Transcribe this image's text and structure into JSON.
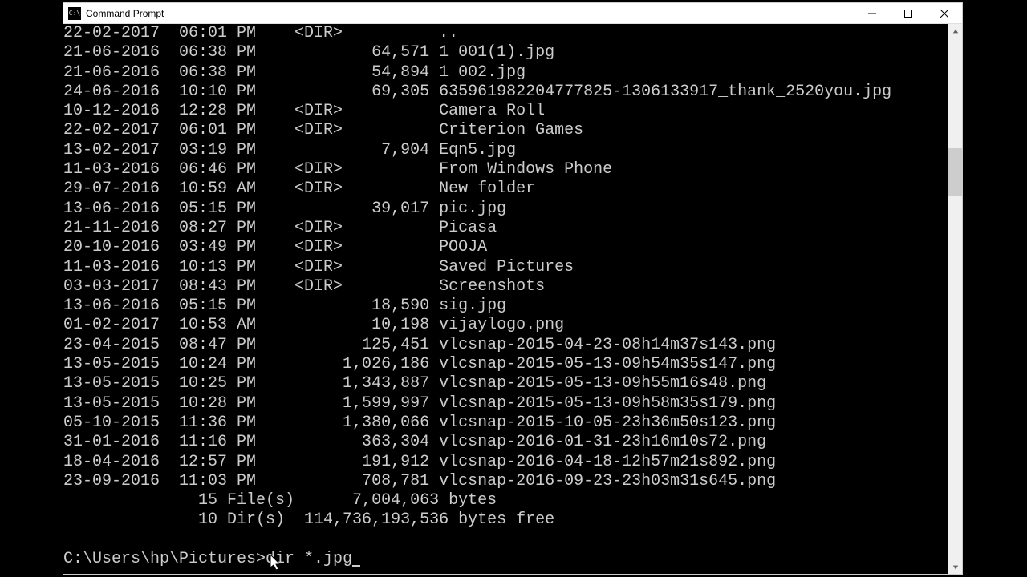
{
  "window": {
    "title": "Command Prompt"
  },
  "entries": [
    {
      "date": "22-02-2017",
      "time": "06:01 PM",
      "dir": true,
      "size": "",
      "name": ".."
    },
    {
      "date": "21-06-2016",
      "time": "06:38 PM",
      "dir": false,
      "size": "64,571",
      "name": "1 001(1).jpg"
    },
    {
      "date": "21-06-2016",
      "time": "06:38 PM",
      "dir": false,
      "size": "54,894",
      "name": "1 002.jpg"
    },
    {
      "date": "24-06-2016",
      "time": "10:10 PM",
      "dir": false,
      "size": "69,305",
      "name": "635961982204777825-1306133917_thank_2520you.jpg"
    },
    {
      "date": "10-12-2016",
      "time": "12:28 PM",
      "dir": true,
      "size": "",
      "name": "Camera Roll"
    },
    {
      "date": "22-02-2017",
      "time": "06:01 PM",
      "dir": true,
      "size": "",
      "name": "Criterion Games"
    },
    {
      "date": "13-02-2017",
      "time": "03:19 PM",
      "dir": false,
      "size": "7,904",
      "name": "Eqn5.jpg"
    },
    {
      "date": "11-03-2016",
      "time": "06:46 PM",
      "dir": true,
      "size": "",
      "name": "From Windows Phone"
    },
    {
      "date": "29-07-2016",
      "time": "10:59 AM",
      "dir": true,
      "size": "",
      "name": "New folder"
    },
    {
      "date": "13-06-2016",
      "time": "05:15 PM",
      "dir": false,
      "size": "39,017",
      "name": "pic.jpg"
    },
    {
      "date": "21-11-2016",
      "time": "08:27 PM",
      "dir": true,
      "size": "",
      "name": "Picasa"
    },
    {
      "date": "20-10-2016",
      "time": "03:49 PM",
      "dir": true,
      "size": "",
      "name": "POOJA"
    },
    {
      "date": "11-03-2016",
      "time": "10:13 PM",
      "dir": true,
      "size": "",
      "name": "Saved Pictures"
    },
    {
      "date": "03-03-2017",
      "time": "08:43 PM",
      "dir": true,
      "size": "",
      "name": "Screenshots"
    },
    {
      "date": "13-06-2016",
      "time": "05:15 PM",
      "dir": false,
      "size": "18,590",
      "name": "sig.jpg"
    },
    {
      "date": "01-02-2017",
      "time": "10:53 AM",
      "dir": false,
      "size": "10,198",
      "name": "vijaylogo.png"
    },
    {
      "date": "23-04-2015",
      "time": "08:47 PM",
      "dir": false,
      "size": "125,451",
      "name": "vlcsnap-2015-04-23-08h14m37s143.png"
    },
    {
      "date": "13-05-2015",
      "time": "10:24 PM",
      "dir": false,
      "size": "1,026,186",
      "name": "vlcsnap-2015-05-13-09h54m35s147.png"
    },
    {
      "date": "13-05-2015",
      "time": "10:25 PM",
      "dir": false,
      "size": "1,343,887",
      "name": "vlcsnap-2015-05-13-09h55m16s48.png"
    },
    {
      "date": "13-05-2015",
      "time": "10:28 PM",
      "dir": false,
      "size": "1,599,997",
      "name": "vlcsnap-2015-05-13-09h58m35s179.png"
    },
    {
      "date": "05-10-2015",
      "time": "11:36 PM",
      "dir": false,
      "size": "1,380,066",
      "name": "vlcsnap-2015-10-05-23h36m50s123.png"
    },
    {
      "date": "31-01-2016",
      "time": "11:16 PM",
      "dir": false,
      "size": "363,304",
      "name": "vlcsnap-2016-01-31-23h16m10s72.png"
    },
    {
      "date": "18-04-2016",
      "time": "12:57 PM",
      "dir": false,
      "size": "191,912",
      "name": "vlcsnap-2016-04-18-12h57m21s892.png"
    },
    {
      "date": "23-09-2016",
      "time": "11:03 PM",
      "dir": false,
      "size": "708,781",
      "name": "vlcsnap-2016-09-23-23h03m31s645.png"
    }
  ],
  "summary": {
    "files_line": "              15 File(s)      7,004,063 bytes",
    "dirs_line": "              10 Dir(s)  114,736,193,536 bytes free"
  },
  "prompt": {
    "path": "C:\\Users\\hp\\Pictures>",
    "command": "dir *.jpg"
  },
  "dir_marker": "<DIR>"
}
